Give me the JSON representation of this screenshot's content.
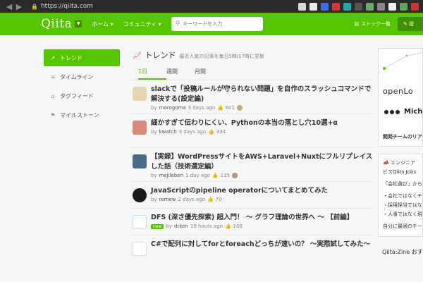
{
  "browser": {
    "back": "◀",
    "forward": "▶",
    "url": "https://qiita.com"
  },
  "header": {
    "logo": "Qiita",
    "nav_home": "ホーム ▾",
    "nav_community": "コミュニティ ▾",
    "search_placeholder": "キーワードを入力",
    "stock_label": "ストック一覧",
    "post_label": "投"
  },
  "sidebar": {
    "items": [
      {
        "label": "トレンド"
      },
      {
        "label": "タイムライン"
      },
      {
        "label": "タグフィード"
      },
      {
        "label": "マイルストーン"
      }
    ]
  },
  "main": {
    "heading": "トレンド",
    "subheading": "最近人気の記事を毎日5時/17時に更新",
    "tabs": [
      "1日",
      "週間",
      "月間"
    ],
    "items": [
      {
        "title": "slackで「投稿ルールが守られない問題」を自作のスラッシュコマンドで解決する(設定編)",
        "by": "by",
        "user": "marogoma",
        "time": "3 days ago",
        "likes": "601",
        "avatar_color": "#e8d6b0"
      },
      {
        "title": "細かすぎて伝わりにくい、Pythonの本当の落とし穴10選+α",
        "by": "by",
        "user": "kwatch",
        "time": "3 days ago",
        "likes": "334",
        "avatar_color": "#d9897a"
      },
      {
        "title": "【実録】WordPressサイトをAWS+Laravel+Nuxtにフルリプレイスした話（技術選定編）",
        "by": "by",
        "user": "mejileben",
        "time": "1 day ago",
        "likes": "115",
        "avatar_color": "#4a6a8a"
      },
      {
        "title": "JavaScriptのpipeline operatorについてまとめてみた",
        "by": "by",
        "user": "remew",
        "time": "2 days ago",
        "likes": "70",
        "avatar_color": "#1a1a1a"
      },
      {
        "title": "DFS (深さ優先探索) 超入門！ 〜 グラフ理論の世界へ 〜 【前編】",
        "badge": "new",
        "by": "by",
        "user": "drken",
        "time": "19 hours ago",
        "likes": "106",
        "avatar_color": "#ffffff"
      },
      {
        "title": "C#で配列に対してforとforeachどっちが速いの？ 〜実際試してみた〜",
        "by": "",
        "user": "",
        "time": "",
        "likes": "",
        "avatar_color": "#ffffff"
      }
    ]
  },
  "right": {
    "ad_logo": "openLo",
    "ad_name": "Mich",
    "ad_caption": "開発チームのリア",
    "jobs_title": "エンジニア",
    "jobs_line1": "ビスQiita Jobs",
    "jobs_line2": "「会社選び」から",
    "jobs_line3": "・会社ではなくチ",
    "jobs_line4": "・採用担当ではな",
    "jobs_line5": "・人事ではなく現",
    "jobs_line6": "自分に最適のチー",
    "zine": "Qiita:Zine おす"
  },
  "colors": {
    "brand": "#55c500",
    "brand_dark": "#3f8f00"
  }
}
